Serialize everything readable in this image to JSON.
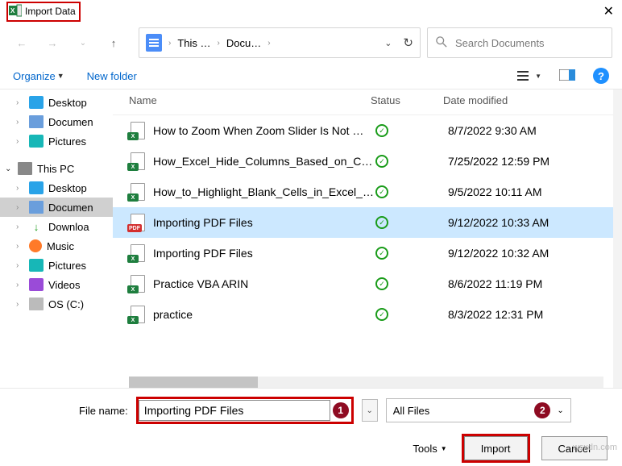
{
  "title": "Import Data",
  "breadcrumb": {
    "p1": "This …",
    "p2": "Docu…"
  },
  "search": {
    "placeholder": "Search Documents"
  },
  "toolbar": {
    "organize": "Organize",
    "newfolder": "New folder"
  },
  "tree": {
    "quick": [
      {
        "label": "Desktop",
        "icon": "desktop"
      },
      {
        "label": "Documen",
        "icon": "doc"
      },
      {
        "label": "Pictures",
        "icon": "pic"
      }
    ],
    "pc_label": "This PC",
    "pc_items": [
      {
        "label": "Desktop",
        "icon": "desktop"
      },
      {
        "label": "Documen",
        "icon": "doc",
        "selected": true
      },
      {
        "label": "Downloa",
        "icon": "dl"
      },
      {
        "label": "Music",
        "icon": "music"
      },
      {
        "label": "Pictures",
        "icon": "pic"
      },
      {
        "label": "Videos",
        "icon": "video"
      },
      {
        "label": "OS (C:)",
        "icon": "drive"
      }
    ]
  },
  "columns": {
    "name": "Name",
    "status": "Status",
    "date": "Date modified"
  },
  "files": [
    {
      "name": "How to Zoom When Zoom Slider Is Not …",
      "type": "xl",
      "date": "8/7/2022 9:30 AM"
    },
    {
      "name": "How_Excel_Hide_Columns_Based_on_Cell…",
      "type": "xl",
      "date": "7/25/2022 12:59 PM"
    },
    {
      "name": "How_to_Highlight_Blank_Cells_in_Excel_V…",
      "type": "xl",
      "date": "9/5/2022 10:11 AM"
    },
    {
      "name": "Importing PDF Files",
      "type": "pdf",
      "date": "9/12/2022 10:33 AM",
      "selected": true
    },
    {
      "name": "Importing PDF Files",
      "type": "xl",
      "date": "9/12/2022 10:32 AM"
    },
    {
      "name": "Practice VBA ARIN",
      "type": "xl",
      "date": "8/6/2022 11:19 PM"
    },
    {
      "name": "practice",
      "type": "xl",
      "date": "8/3/2022 12:31 PM"
    }
  ],
  "footer": {
    "filename_label": "File name:",
    "filename_value": "Importing PDF Files",
    "filter": "All Files",
    "tools": "Tools",
    "import": "Import",
    "cancel": "Cancel"
  },
  "badges": {
    "one": "1",
    "two": "2"
  },
  "watermark": "wsxdn.com"
}
